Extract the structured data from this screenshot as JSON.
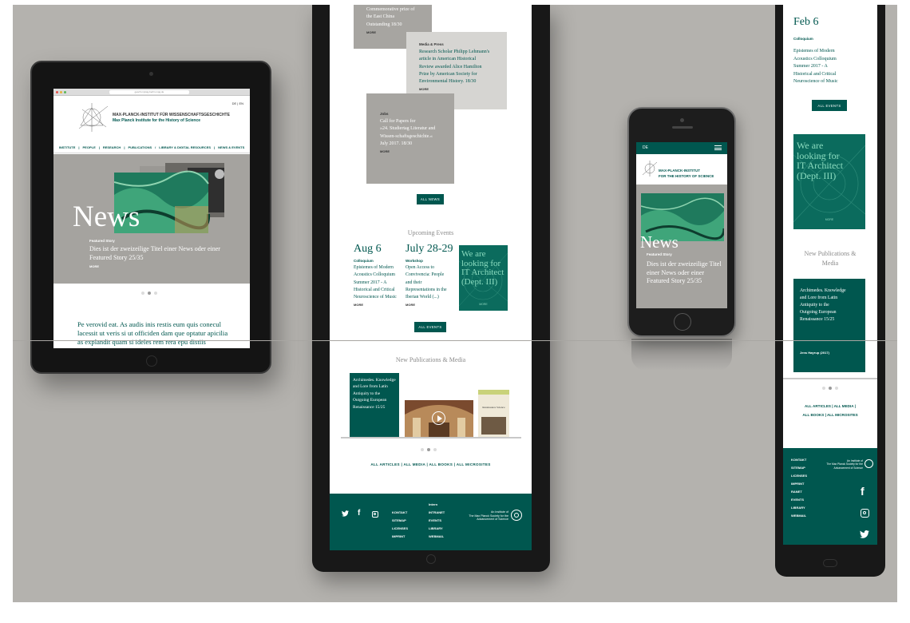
{
  "tablet": {
    "url_text": "gesch.mpiwg-berlin.mpg.de",
    "lang": "DE | EN",
    "institute_de": "MAX-PLANCK-INSTITUT FÜR WISSENSCHAFTSGESCHICHTE",
    "institute_en": "Max Planck Institute for the History of Science",
    "nav": [
      "INSTITUTE",
      "|",
      "PEOPLE",
      "|",
      "RESEARCH",
      "|",
      "PUBLICATIONS",
      "/",
      "LIBRARY & DIGITAL RESOURCES",
      "|",
      "NEWS & EVENTS"
    ],
    "hero_title": "News",
    "featured_label": "Featured Story",
    "featured_text": "Dies ist der zweizeilige Titel einer News oder einer Featured Story 25/35",
    "more": "MORE",
    "body_text": "Pe verovid eat. As audis inis restis eum quis conecul lacessit ut veris si ut officiden dam que optatur apicilia as explandit quam si ideles rem rera epu distiis"
  },
  "center": {
    "top_card": {
      "lines": [
        "Commemorative prize of",
        "the East China",
        "Outstanding 18/30"
      ],
      "more": "MORE"
    },
    "media_card": {
      "category": "Media & Press",
      "lines": [
        "Research Scholar Philipp Lehmann's",
        "article in American Historical",
        "Review awarded Alice Hamilton",
        "Prize by American Society for",
        "Environmental History. 18/30"
      ],
      "more": "MORE"
    },
    "jobs_card": {
      "category": "Jobs",
      "lines": [
        "Call for Papers for",
        "»24. Studiertag Literatur and",
        "Wissen-schaftsgeschichte.«",
        "July 2017. 18/30"
      ],
      "more": "MORE"
    },
    "all_news": "ALL NEWS",
    "upcoming_heading": "Upcoming Events",
    "events": [
      {
        "date": "Aug 6",
        "type": "Colloquium",
        "lines": [
          "Epistemes of Modern",
          "Acoustics Colloquium",
          "Summer 2017 - A",
          "Historical and Critical",
          "Neuroscience of Music"
        ],
        "more": "MORE"
      },
      {
        "date": "July 28-29",
        "type": "Workshop",
        "lines": [
          "Open Access to",
          "Convivencia: People",
          "and their",
          "Representations in the",
          "Iberian World (...)"
        ],
        "more": "MORE"
      }
    ],
    "promo_lines": [
      "We are",
      "looking for",
      "IT Architect",
      "(Dept. III)"
    ],
    "promo_label": "MORE",
    "all_events": "ALL EVENTS",
    "pub_heading": "New Publications & Media",
    "pub_card_lines": [
      "Archimedes. Knowledge",
      "and Lore from Latin",
      "Antiquity to the",
      "Outgoing European",
      "Renaissance 15/25"
    ],
    "book_cover_title": "Renaissance Science",
    "links": "ALL ARTICLES  |  ALL MEDIA  |  ALL BOOKS  |  ALL MICROSITES",
    "footer": {
      "col1": [
        "KONTAKT",
        "SITEMAP",
        "LICENSES",
        "IMPRINT"
      ],
      "col2_title": "Intern",
      "col2": [
        "INTRANET",
        "EVENTS",
        "LIBRARY",
        "WEBMAIL"
      ],
      "mpg": [
        "An Institute of",
        "The Max Planck Society for the",
        "Advancement of Science"
      ]
    }
  },
  "small_phone": {
    "lang": "DE",
    "institute_de": "MAX-PLANCK-INSTITUT",
    "institute_en": "FOR THE HISTORY OF SCIENCE",
    "hero_title": "News",
    "featured_label": "Featured Story",
    "featured_text": "Dies ist der zweizeilige Titel einer News oder einer Featured Story 25/35"
  },
  "right_phone": {
    "date": "Feb 6",
    "type": "Colloquium",
    "lines": [
      "Epistemes of Modern",
      "Acoustics Colloquium",
      "Summer 2017 - A",
      "Historical and Critical",
      "Neuroscience of Music"
    ],
    "all_events": "ALL EVENTS",
    "promo_lines": [
      "We are",
      "looking for",
      "IT Architect",
      "(Dept. III)"
    ],
    "promo_label": "MORE",
    "pub_heading_lines": [
      "New Publications &",
      "Media"
    ],
    "pub_card_lines": [
      "Archimedes. Knowledge",
      "and Lore from Latin",
      "Antiquity to the",
      "Outgoing European",
      "Renaissance 15/25"
    ],
    "pub_author": "Jens Høyrup (2017)",
    "links_line1": "ALL ARTICLES  |  ALL MEDIA  |",
    "links_line2": "ALL BOOKS  |  ALL MICROSITES",
    "footer_links": [
      "KONTAKT",
      "SITEMAP",
      "LICENSES",
      "IMPRINT",
      "RANET",
      "EVENTS",
      "LIBRARY",
      "WEBMAIL"
    ],
    "mpg": [
      "An Institute of",
      "The Max Planck Society for the",
      "Advancement of Science"
    ]
  },
  "colors": {
    "teal": "#00574f",
    "stage": "#b4b2ae",
    "card_grey": "#a7a5a1",
    "card_light": "#d6d5d2"
  },
  "icons": [
    "twitter-icon",
    "facebook-icon",
    "instagram-icon",
    "play-icon",
    "menu-icon",
    "mpg-logo-icon"
  ]
}
